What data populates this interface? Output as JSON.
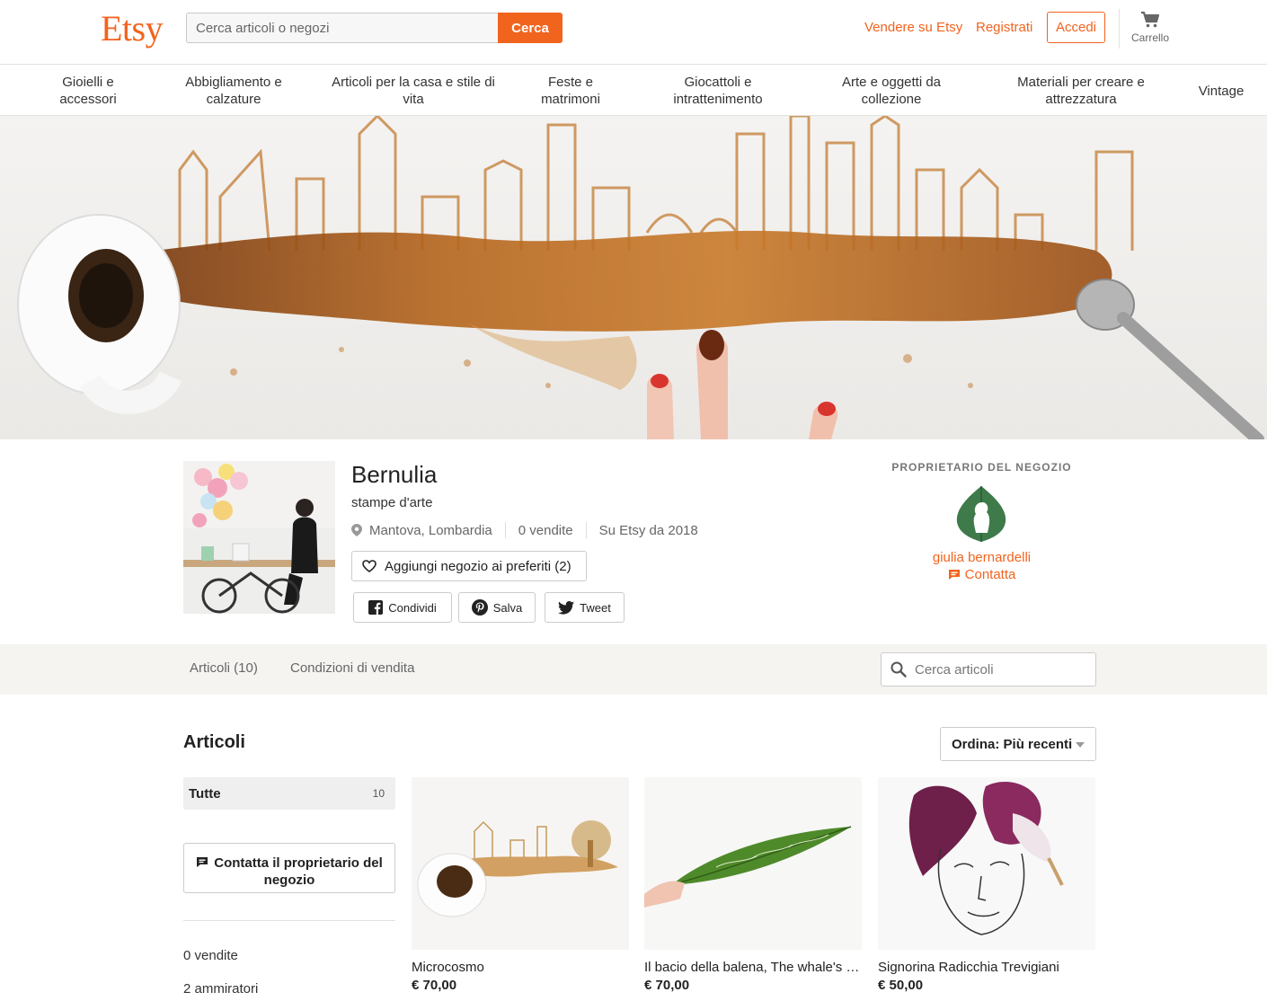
{
  "header": {
    "logo": "Etsy",
    "search_placeholder": "Cerca articoli o negozi",
    "search_button": "Cerca",
    "sell_link": "Vendere su Etsy",
    "register_link": "Registrati",
    "login_button": "Accedi",
    "cart_label": "Carrello"
  },
  "categories": [
    "Gioielli e accessori",
    "Abbigliamento e calzature",
    "Articoli per la casa e stile di vita",
    "Feste e matrimoni",
    "Giocattoli e intrattenimento",
    "Arte e oggetti da collezione",
    "Materiali per creare e attrezzatura",
    "Vintage"
  ],
  "shop": {
    "name": "Bernulia",
    "tagline": "stampe d'arte",
    "location": "Mantova, Lombardia",
    "sales": "0 vendite",
    "since": "Su Etsy da 2018",
    "favorite_button": "Aggiungi negozio ai preferiti (2)",
    "share": {
      "facebook": "Condividi",
      "pinterest": "Salva",
      "twitter": "Tweet"
    }
  },
  "owner": {
    "title": "PROPRIETARIO DEL NEGOZIO",
    "name": "giulia bernardelli",
    "contact": "Contatta"
  },
  "tabs": {
    "items": "Articoli (10)",
    "policies": "Condizioni di vendita",
    "search_placeholder": "Cerca articoli"
  },
  "items_section": {
    "title": "Articoli",
    "sort_label": "Ordina:",
    "sort_value": "Più recenti",
    "sidebar_all_label": "Tutte",
    "sidebar_all_count": "10",
    "contact_owner_button": "Contatta il proprietario del negozio",
    "stats": [
      "0 vendite",
      "2 ammiratori"
    ]
  },
  "listings": [
    {
      "title": "Microcosmo",
      "price": "€ 70,00"
    },
    {
      "title": "Il bacio della balena, The whale's kiss",
      "price": "€ 70,00"
    },
    {
      "title": "Signorina Radicchia Trevigiani",
      "price": "€ 50,00"
    }
  ],
  "colors": {
    "brand": "#f1641e",
    "coffee": "#b5651d",
    "tabs_bg": "#f5f4f1"
  }
}
